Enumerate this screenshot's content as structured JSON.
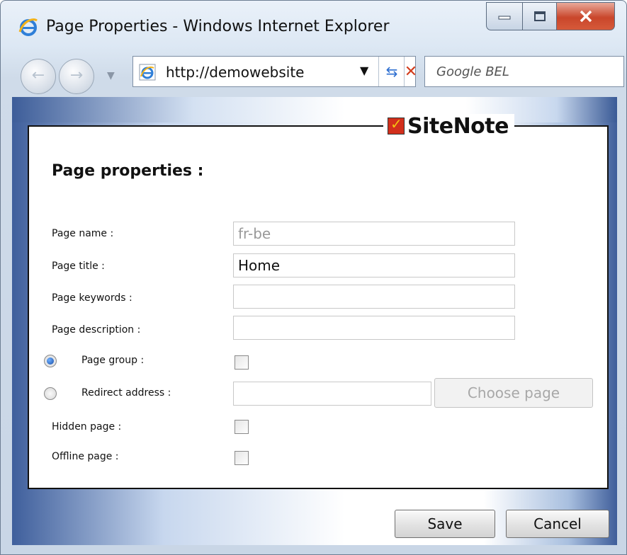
{
  "window": {
    "title": "Page Properties - Windows Internet Explorer"
  },
  "navbar": {
    "address": "http://demowebsite",
    "search_placeholder": "Google BEL"
  },
  "logo": {
    "text": "SiteNote"
  },
  "form": {
    "heading": "Page properties :",
    "page_name_label": "Page name :",
    "page_name_value": "fr-be",
    "page_title_label": "Page title :",
    "page_title_value": "Home",
    "page_keywords_label": "Page keywords :",
    "page_keywords_value": "",
    "page_description_label": "Page description :",
    "page_description_value": "",
    "page_group_label": "Page group :",
    "page_group_selected": true,
    "redirect_address_label": "Redirect address :",
    "redirect_address_value": "",
    "choose_page_label": "Choose page",
    "hidden_page_label": "Hidden page :",
    "offline_page_label": "Offline page :"
  },
  "footer": {
    "save_label": "Save",
    "cancel_label": "Cancel"
  },
  "colors": {
    "accent_blue": "#3f5f9c",
    "close_red": "#c9462b"
  }
}
